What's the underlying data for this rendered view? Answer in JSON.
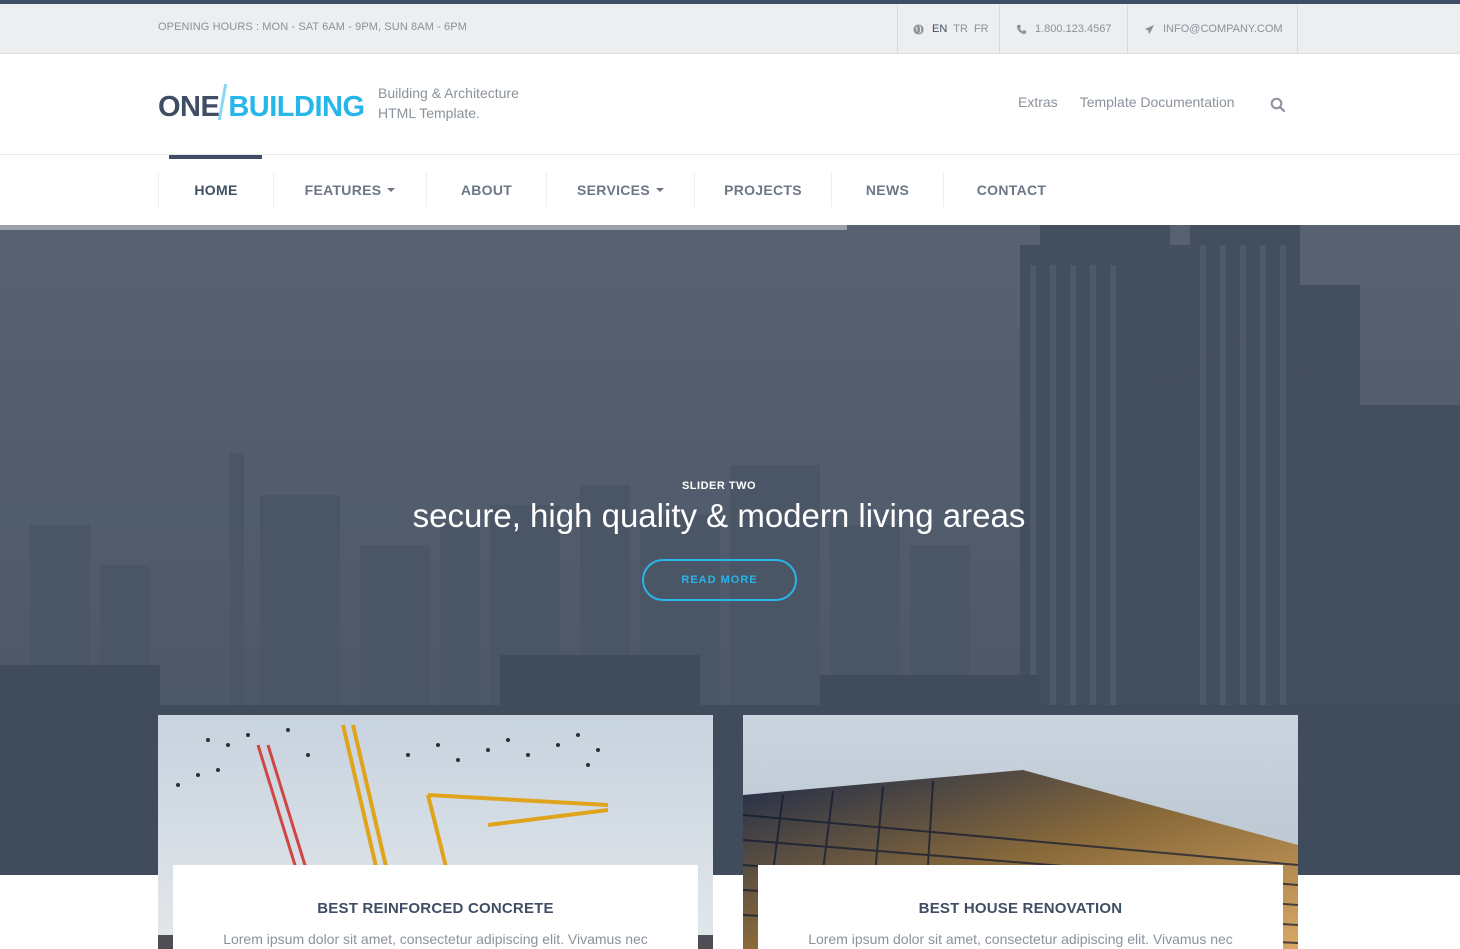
{
  "topbar": {
    "hours": "OPENING HOURS : MON - SAT 6AM - 9PM, SUN 8AM - 6PM",
    "languages": [
      "EN",
      "TR",
      "FR"
    ],
    "active_language": "EN",
    "phone": "1.800.123.4567",
    "email": "INFO@COMPANY.COM"
  },
  "header": {
    "logo_part1": "ONE",
    "logo_part2": "BUILDING",
    "tagline_line1": "Building & Architecture",
    "tagline_line2": "HTML Template.",
    "links": [
      "Extras",
      "Template Documentation"
    ],
    "search_icon": "search-icon"
  },
  "nav": {
    "items": [
      {
        "label": "HOME",
        "active": true
      },
      {
        "label": "FEATURES",
        "dropdown": true
      },
      {
        "label": "ABOUT"
      },
      {
        "label": "SERVICES",
        "dropdown": true
      },
      {
        "label": "PROJECTS"
      },
      {
        "label": "NEWS"
      },
      {
        "label": "CONTACT"
      }
    ]
  },
  "hero": {
    "kicker": "SLIDER TWO",
    "title": "secure, high quality & modern living areas",
    "button": "READ MORE",
    "slide_progress": 0.58
  },
  "cards": [
    {
      "title": "BEST REINFORCED CONCRETE",
      "text": "Lorem ipsum dolor sit amet, consectetur adipiscing elit. Vivamus nec"
    },
    {
      "title": "BEST HOUSE RENOVATION",
      "text": "Lorem ipsum dolor sit amet, consectetur adipiscing elit. Vivamus nec"
    }
  ],
  "colors": {
    "primary": "#3f4e64",
    "accent": "#27b6e9",
    "muted": "#8a929c",
    "topbar_bg": "#eceeef"
  }
}
